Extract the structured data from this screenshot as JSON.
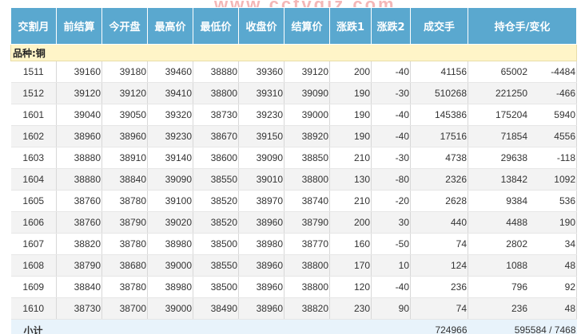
{
  "watermark": "www.cctvgjz.com",
  "headers": [
    "交割月",
    "前结算",
    "今开盘",
    "最高价",
    "最低价",
    "收盘价",
    "结算价",
    "涨跌1",
    "涨跌2",
    "成交手",
    "持仓手/变化"
  ],
  "category_label": "品种:铜",
  "rows": [
    [
      "1511",
      "39160",
      "39180",
      "39460",
      "38880",
      "39360",
      "39120",
      "200",
      "-40",
      "41156",
      "65002",
      "-4484"
    ],
    [
      "1512",
      "39120",
      "39120",
      "39410",
      "38800",
      "39310",
      "39090",
      "190",
      "-30",
      "510268",
      "221250",
      "-466"
    ],
    [
      "1601",
      "39040",
      "39050",
      "39320",
      "38730",
      "39230",
      "39000",
      "190",
      "-40",
      "145386",
      "175204",
      "5940"
    ],
    [
      "1602",
      "38960",
      "38960",
      "39230",
      "38670",
      "39150",
      "38920",
      "190",
      "-40",
      "17516",
      "71854",
      "4556"
    ],
    [
      "1603",
      "38880",
      "38910",
      "39140",
      "38600",
      "39090",
      "38850",
      "210",
      "-30",
      "4738",
      "29638",
      "-118"
    ],
    [
      "1604",
      "38880",
      "38840",
      "39090",
      "38550",
      "39010",
      "38800",
      "130",
      "-80",
      "2326",
      "13842",
      "1092"
    ],
    [
      "1605",
      "38760",
      "38780",
      "39100",
      "38520",
      "38970",
      "38740",
      "210",
      "-20",
      "2628",
      "9384",
      "536"
    ],
    [
      "1606",
      "38760",
      "38790",
      "39020",
      "38520",
      "38960",
      "38790",
      "200",
      "30",
      "440",
      "4488",
      "190"
    ],
    [
      "1607",
      "38820",
      "38780",
      "38980",
      "38500",
      "38980",
      "38770",
      "160",
      "-50",
      "74",
      "2802",
      "34"
    ],
    [
      "1608",
      "38790",
      "38680",
      "39000",
      "38550",
      "38960",
      "38800",
      "170",
      "10",
      "124",
      "1088",
      "48"
    ],
    [
      "1609",
      "38840",
      "38780",
      "38980",
      "38500",
      "38960",
      "38800",
      "120",
      "-40",
      "236",
      "796",
      "92"
    ],
    [
      "1610",
      "38730",
      "38700",
      "39000",
      "38490",
      "38960",
      "38820",
      "230",
      "90",
      "74",
      "236",
      "48"
    ]
  ],
  "subtotal": {
    "label": "小计",
    "volume": "724966",
    "open_interest": "595584 / 7468"
  }
}
